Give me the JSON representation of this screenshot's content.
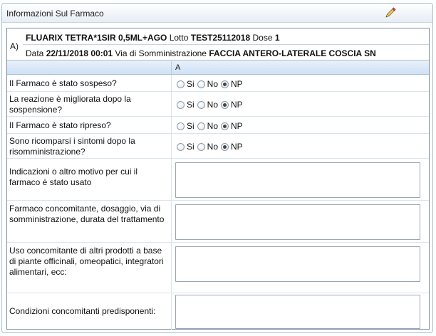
{
  "panel": {
    "title": "Informazioni Sul Farmaco",
    "edit_icon": "pencil-icon"
  },
  "drug": {
    "letter": "A)",
    "name": "FLUARIX TETRA*1SIR 0,5ML+AGO",
    "lot_label": "Lotto",
    "lot": "TEST25112018",
    "dose_label": "Dose",
    "dose": "1",
    "date_label": "Data",
    "date": "22/11/2018 00:01",
    "route_label": "Via di Somministrazione",
    "route": "FACCIA ANTERO-LATERALE COSCIA SN"
  },
  "table": {
    "column_header": "A",
    "radio_options": [
      "Si",
      "No",
      "NP"
    ],
    "questions": [
      {
        "label": "Il Farmaco è stato sospeso?",
        "selected": "NP"
      },
      {
        "label": "La reazione è migliorata dopo la sospensione?",
        "selected": "NP"
      },
      {
        "label": "Il Farmaco è stato ripreso?",
        "selected": "NP"
      },
      {
        "label": "Sono ricomparsi i sintomi dopo la risomministrazione?",
        "selected": "NP"
      }
    ],
    "text_fields": [
      {
        "label": "Indicazioni o altro motivo per cui il farmaco è stato usato",
        "value": ""
      },
      {
        "label": "Farmaco concomitante, dosaggio, via di somministrazione, durata del trattamento",
        "value": ""
      },
      {
        "label": "Uso concomitante di altri prodotti a base di piante officinali, omeopatici, integratori alimentari, ecc:",
        "value": ""
      },
      {
        "label": "Condizioni concomitanti predisponenti:",
        "value": ""
      }
    ]
  }
}
